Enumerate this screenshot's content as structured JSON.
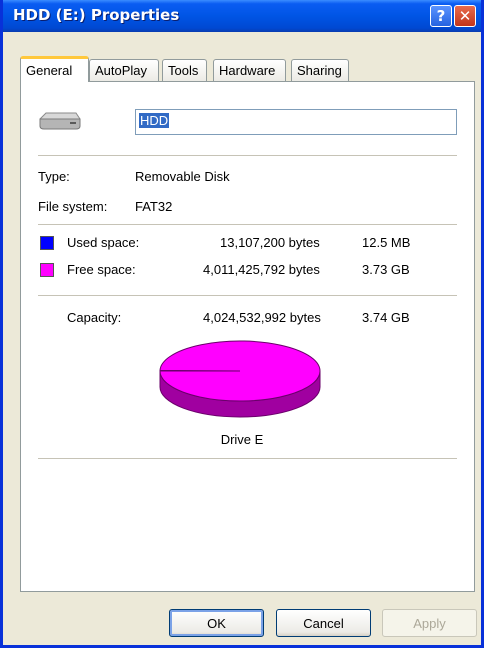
{
  "window": {
    "title": "HDD (E:) Properties",
    "help_glyph": "?",
    "close_glyph": "✕"
  },
  "tabs": [
    {
      "label": "General",
      "active": true
    },
    {
      "label": "AutoPlay"
    },
    {
      "label": "Tools"
    },
    {
      "label": "Hardware"
    },
    {
      "label": "Sharing"
    }
  ],
  "general": {
    "drive_icon": "removable-drive-icon",
    "name_value": "HDD",
    "type_label": "Type:",
    "type_value": "Removable Disk",
    "fs_label": "File system:",
    "fs_value": "FAT32",
    "used": {
      "label": "Used space:",
      "bytes": "13,107,200 bytes",
      "size": "12.5 MB",
      "color": "#0000ff"
    },
    "free": {
      "label": "Free space:",
      "bytes": "4,011,425,792 bytes",
      "size": "3.73 GB",
      "color": "#ff00ff"
    },
    "capacity": {
      "label": "Capacity:",
      "bytes": "4,024,532,992 bytes",
      "size": "3.74 GB"
    },
    "drive_label": "Drive E"
  },
  "chart_data": {
    "type": "pie",
    "categories": [
      "Used space",
      "Free space"
    ],
    "values": [
      13107200,
      4011425792
    ],
    "colors": [
      "#0000ff",
      "#ff00ff"
    ]
  },
  "buttons": {
    "ok": "OK",
    "cancel": "Cancel",
    "apply": "Apply"
  }
}
